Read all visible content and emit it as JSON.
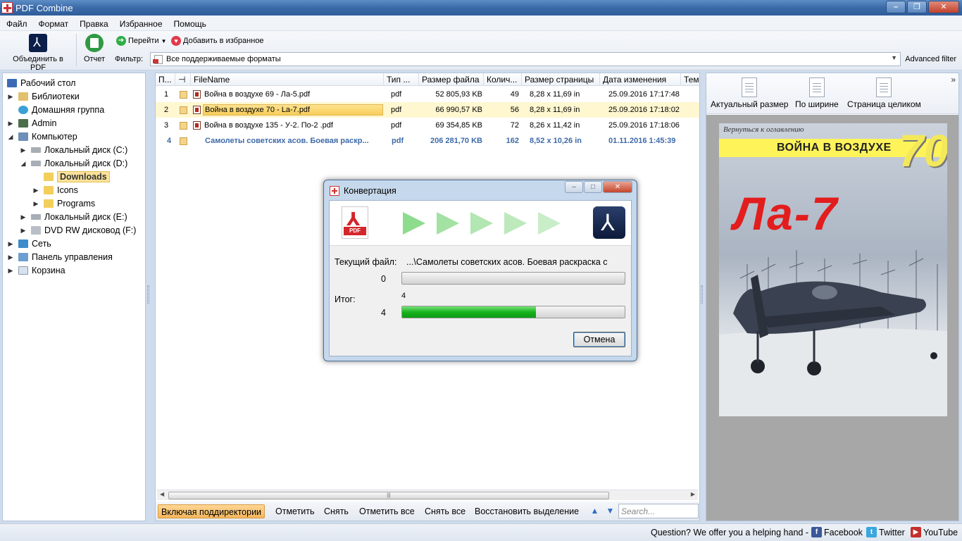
{
  "window": {
    "title": "PDF Combine",
    "controls": [
      "–",
      "❐",
      "✕"
    ]
  },
  "menu": [
    "Файл",
    "Формат",
    "Правка",
    "Избранное",
    "Помощь"
  ],
  "toolbar": {
    "combine_label": "Объединить в PDF",
    "report_label": "Отчет",
    "go_label": "Перейти",
    "favorite_label": "Добавить в избранное",
    "filter_label": "Фильтр:",
    "filter_value": "Все поддерживаемые форматы",
    "advanced_filter": "Advanced filter"
  },
  "tree": {
    "desktop": "Рабочий стол",
    "libraries": "Библиотеки",
    "homegroup": "Домашняя группа",
    "admin": "Admin",
    "computer": "Компьютер",
    "disk_c": "Локальный диск (C:)",
    "disk_d": "Локальный диск (D:)",
    "downloads": "Downloads",
    "icons": "Icons",
    "programs": "Programs",
    "disk_e": "Локальный диск (E:)",
    "dvd": "DVD RW дисковод (F:)",
    "network": "Сеть",
    "control_panel": "Панель управления",
    "recycle_bin": "Корзина"
  },
  "columns": [
    "П...",
    "FileName",
    "Тип ...",
    "Размер файла",
    "Колич...",
    "Размер страницы",
    "Дата изменения",
    "Тем"
  ],
  "files": [
    {
      "n": "1",
      "name": "Война в воздухе 69 - Ла-5.pdf",
      "type": "pdf",
      "size": "52 805,93 KB",
      "pages": "49",
      "page_size": "8,28 x 11,69 in",
      "date": "25.09.2016 17:17:48"
    },
    {
      "n": "2",
      "name": "Война в воздухе 70 - La-7.pdf",
      "type": "pdf",
      "size": "66 990,57 KB",
      "pages": "56",
      "page_size": "8,28 x 11,69 in",
      "date": "25.09.2016 17:18:02"
    },
    {
      "n": "3",
      "name": "Война в воздухе 135 - У-2. По-2 .pdf",
      "type": "pdf",
      "size": "69 354,85 KB",
      "pages": "72",
      "page_size": "8,26 x 11,42 in",
      "date": "25.09.2016 17:18:06"
    },
    {
      "n": "4",
      "name": "Самолеты советских асов. Боевая раскр...",
      "type": "pdf",
      "size": "206 281,70 KB",
      "pages": "162",
      "page_size": "8,52 x 10,26 in",
      "date": "01.11.2016 1:45:39"
    }
  ],
  "bottom_bar": {
    "include_subdirs": "Включая поддиректории",
    "mark": "Отметить",
    "unmark": "Снять",
    "mark_all": "Отметить все",
    "unmark_all": "Снять все",
    "restore_selection": "Восстановить выделение",
    "search_placeholder": "Search..."
  },
  "preview": {
    "actual_size": "Актуальный размер",
    "fit_width": "По ширине",
    "whole_page": "Страница целиком",
    "more": "»",
    "cover": {
      "toc_link": "Вернуться к оглавлению",
      "series": "ВОЙНА В ВОЗДУХЕ",
      "number": "70",
      "title": "Ла-7"
    }
  },
  "dialog": {
    "title": "Конвертация",
    "current_file_label": "Текущий файл:",
    "current_file": "...\\Самолеты советских асов. Боевая раскраска с",
    "current_count": "0",
    "current_progress": 0,
    "total_label": "Итог:",
    "total_top": "4",
    "total_count": "4",
    "total_progress": 0.6,
    "cancel": "Отмена",
    "pdf_tag": "PDF",
    "colors": {
      "arrow_fill": "#9be39b",
      "arrow_edge": "#3fbf3f",
      "progress": "#17b41c"
    }
  },
  "status": {
    "question": "Question? We offer you a helping hand -",
    "facebook": "Facebook",
    "twitter": "Twitter",
    "youtube": "YouTube"
  }
}
